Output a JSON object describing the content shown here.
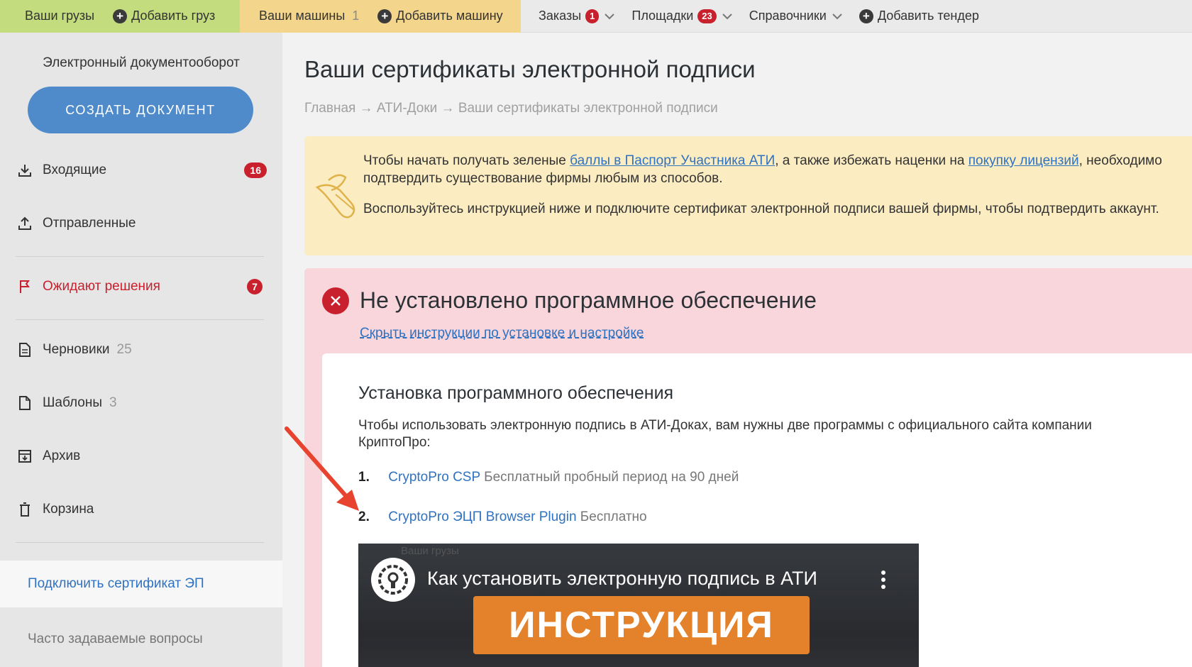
{
  "topnav": {
    "cargo": {
      "your_cargo": "Ваши грузы",
      "add_cargo": "Добавить груз"
    },
    "trucks": {
      "your_trucks": "Ваши машины",
      "trucks_count": "1",
      "add_truck": "Добавить машину"
    },
    "orders": {
      "label": "Заказы",
      "badge": "1"
    },
    "sites": {
      "label": "Площадки",
      "badge": "23"
    },
    "directories": {
      "label": "Справочники"
    },
    "add_tender": "Добавить тендер"
  },
  "sidebar": {
    "title": "Электронный документооборот",
    "create_button": "СОЗДАТЬ ДОКУМЕНТ",
    "items": [
      {
        "label": "Входящие",
        "badge": "16",
        "icon": "download-icon"
      },
      {
        "label": "Отправленные",
        "icon": "upload-icon"
      },
      {
        "label": "Ожидают решения",
        "badge": "7",
        "icon": "flag-icon"
      },
      {
        "label": "Черновики",
        "count": "25",
        "icon": "document-icon"
      },
      {
        "label": "Шаблоны",
        "count": "3",
        "icon": "file-icon"
      },
      {
        "label": "Архив",
        "icon": "archive-icon"
      },
      {
        "label": "Корзина",
        "icon": "trash-icon"
      }
    ],
    "active_link": "Подключить сертификат ЭП",
    "faq": "Часто задаваемые вопросы"
  },
  "main": {
    "title": "Ваши сертификаты электронной подписи",
    "breadcrumb": [
      "Главная",
      "АТИ-Доки",
      "Ваши сертификаты электронной подписи"
    ],
    "breadcrumb_sep": "→",
    "notice": {
      "p1_a": "Чтобы начать получать зеленые ",
      "p1_link1": "баллы в Паспорт Участника АТИ",
      "p1_b": ", а также избежать наценки на ",
      "p1_link2": "покупку лицензий",
      "p1_c": ", необходимо подтвердить существование фирмы любым из способов.",
      "p2": "Воспользуйтесь инструкцией ниже и подключите сертификат электронной подписи вашей фирмы, чтобы подтвердить аккаунт."
    },
    "error": {
      "title": "Не установлено программное обеспечение",
      "toggle_link": "Скрыть инструкции по установке и настройке"
    },
    "install": {
      "title": "Установка программного обеспечения",
      "desc": "Чтобы использовать электронную подпись в АТИ-Доках, вам нужны две программы с официального сайта компании КриптоПро:",
      "items": [
        {
          "num": "1.",
          "link": "CryptoPro CSP",
          "note": "Бесплатный пробный период на 90 дней"
        },
        {
          "num": "2.",
          "link": "CryptoPro ЭЦП Browser Plugin",
          "note": "Бесплатно"
        }
      ]
    },
    "video": {
      "ghost": "Ваши грузы",
      "title": "Как установить электронную подпись в АТИ",
      "banner": "ИНСТРУКЦИЯ"
    }
  },
  "colors": {
    "cargo_bg": "#c3dd7e",
    "trucks_bg": "#f3d58c",
    "accent_blue": "#4f8bcb",
    "link_blue": "#2f72c1",
    "badge_red": "#c9202e",
    "notice_bg": "#fbecc2",
    "error_bg": "#f8d6db",
    "annotation_arrow": "#e8432e"
  }
}
